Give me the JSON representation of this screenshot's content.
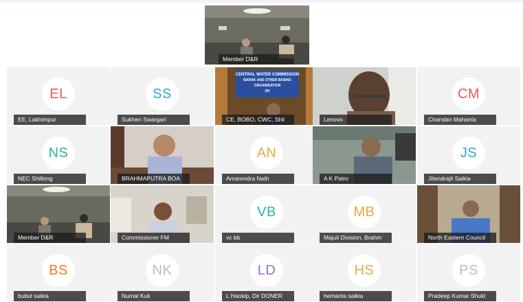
{
  "spotlight": {
    "name": "Member D&R"
  },
  "participants": [
    {
      "name": "EE, Lakhimpur",
      "initials": "EL",
      "color": "#e5584f",
      "video": false
    },
    {
      "name": "Sukhen Swargari",
      "initials": "SS",
      "color": "#2aa9d6",
      "video": false
    },
    {
      "name": "CE, BOBO, CWC, Shil",
      "video": true,
      "scene": "cwc"
    },
    {
      "name": "Lenovo",
      "video": true,
      "scene": "lenovo"
    },
    {
      "name": "Chandan Mahanta",
      "initials": "CM",
      "color": "#e5584f",
      "video": false
    },
    {
      "name": "NEC Shillong",
      "initials": "NS",
      "color": "#2ab4a6",
      "video": false
    },
    {
      "name": "BRAHMAPUTRA BOA",
      "video": true,
      "scene": "brahmaputra"
    },
    {
      "name": "Amarendra Nath",
      "initials": "AN",
      "color": "#e8a93a",
      "video": false
    },
    {
      "name": "A K Patro",
      "video": true,
      "scene": "patro"
    },
    {
      "name": "Jitendrajit Saikia",
      "initials": "JS",
      "color": "#2aa9d6",
      "video": false
    },
    {
      "name": "Member D&R",
      "video": true,
      "scene": "member"
    },
    {
      "name": "Commissioner FM",
      "video": true,
      "scene": "commissioner"
    },
    {
      "name": "vc bb",
      "initials": "VB",
      "color": "#2ab4a6",
      "video": false
    },
    {
      "name": "Majuli Division, Brahm",
      "initials": "MB",
      "color": "#e8a93a",
      "video": false
    },
    {
      "name": "North Eastern Council",
      "video": true,
      "scene": "nec"
    },
    {
      "name": "bubul saikia",
      "initials": "BS",
      "color": "#f07a2a",
      "video": false
    },
    {
      "name": "Numal Kuli",
      "initials": "NK",
      "color": "#b9bec4",
      "video": false
    },
    {
      "name": "L Haokip, Dir DONER",
      "initials": "LD",
      "color": "#9a6fc6",
      "video": false
    },
    {
      "name": "hemanta saikia",
      "initials": "HS",
      "color": "#e8a93a",
      "video": false
    },
    {
      "name": "Pradeep Kumar Shukl",
      "initials": "PS",
      "color": "#b9bec4",
      "video": false
    }
  ],
  "cwc_sign": [
    "CENTRAL WATER COMMISSION",
    "BARAK AND OTHER BASINS",
    "ORGANISATION",
    "SH"
  ]
}
